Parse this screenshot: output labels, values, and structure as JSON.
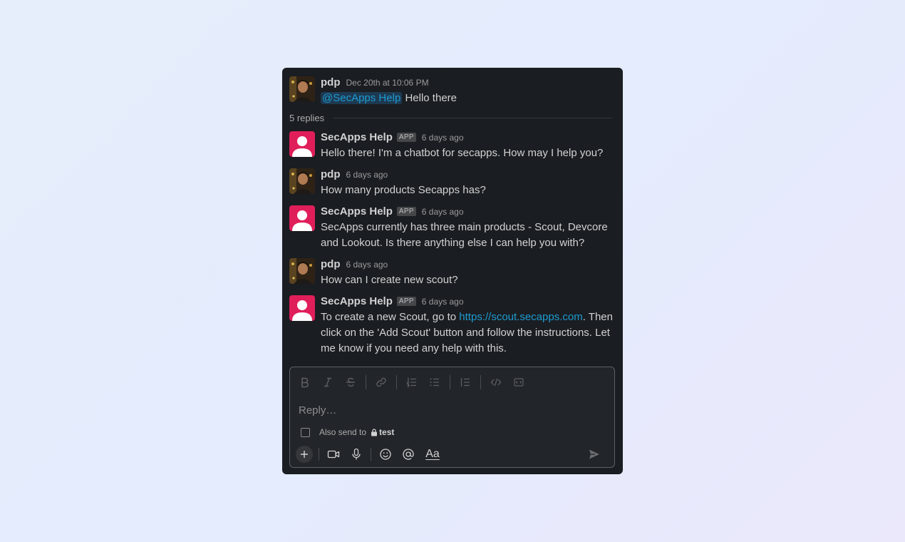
{
  "thread": {
    "root": {
      "author": "pdp",
      "time": "Dec 20th at 10:06 PM",
      "mention": "@SecApps Help",
      "text": "Hello there"
    },
    "replies_count": "5 replies",
    "replies": [
      {
        "author": "SecApps Help",
        "badge": "APP",
        "time": "6 days ago",
        "text": "Hello there! I'm a chatbot for secapps. How may I help you?"
      },
      {
        "author": "pdp",
        "time": "6 days ago",
        "text": "How many products Secapps has?"
      },
      {
        "author": "SecApps Help",
        "badge": "APP",
        "time": "6 days ago",
        "text": "SecApps currently has three main products - Scout, Devcore and Lookout. Is there anything else I can help you with?"
      },
      {
        "author": "pdp",
        "time": "6 days ago",
        "text": "How can I create new scout?"
      },
      {
        "author": "SecApps Help",
        "badge": "APP",
        "time": "6 days ago",
        "text_before": "To create a new Scout, go to ",
        "link": "https://scout.secapps.com",
        "text_after": ". Then click on the 'Add Scout' button and follow the instructions. Let me know if you need any help with this."
      }
    ]
  },
  "composer": {
    "placeholder": "Reply…",
    "also_send_label": "Also send to",
    "channel": "test",
    "format_label": "Aa",
    "toolbar_icons": [
      "bold-icon",
      "italic-icon",
      "strikethrough-icon",
      "link-icon",
      "ordered-list-icon",
      "bulleted-list-icon",
      "blockquote-icon",
      "code-icon",
      "code-block-icon"
    ],
    "bottom_icons": [
      "plus-icon",
      "video-icon",
      "microphone-icon",
      "emoji-icon",
      "mention-icon",
      "format-icon",
      "send-icon"
    ]
  },
  "colors": {
    "background": "#1a1d21",
    "bot_avatar": "#e01e5a",
    "link": "#1d9bd1",
    "text": "#d1d2d3"
  }
}
